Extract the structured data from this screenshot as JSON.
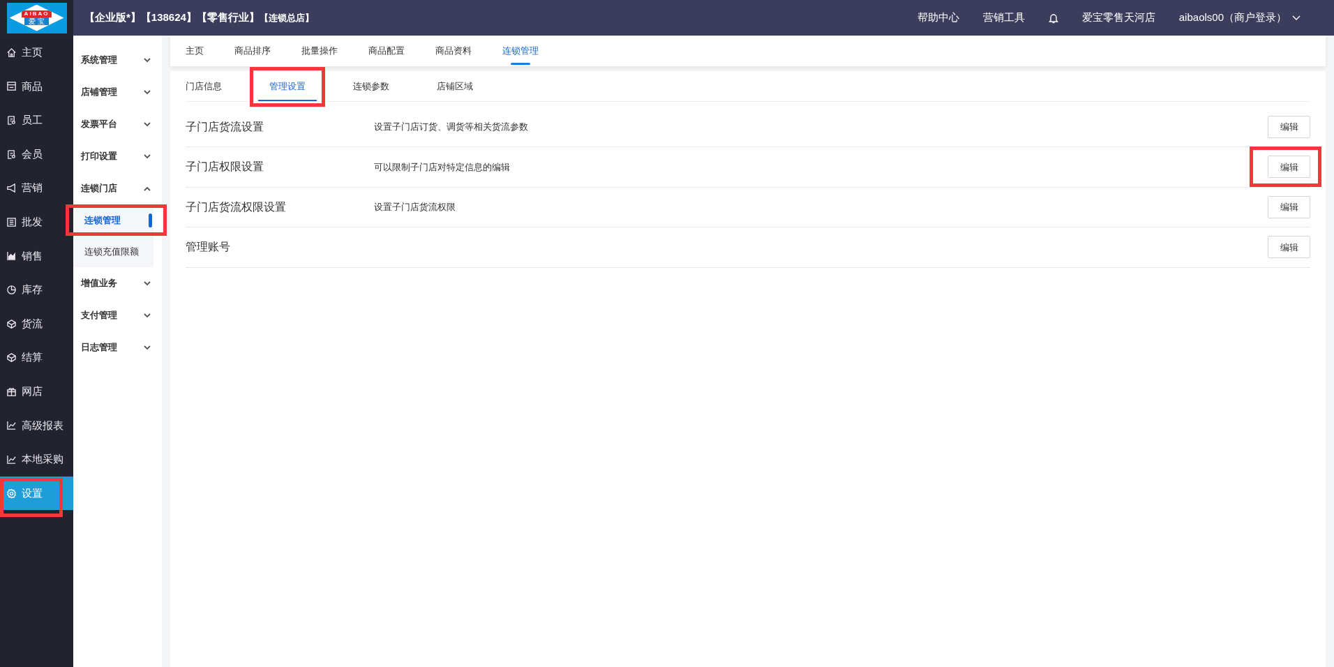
{
  "logo": {
    "brand": "AIBAO",
    "subtitle": "爱 宝"
  },
  "header": {
    "tags": [
      {
        "text": "【企业版*】",
        "small": false
      },
      {
        "text": "【138624】",
        "small": false
      },
      {
        "text": "【零售行业】",
        "small": false
      },
      {
        "text": "【连锁总店】",
        "small": true
      }
    ],
    "links": [
      "帮助中心",
      "营销工具"
    ],
    "store": "爱宝零售天河店",
    "user": "aibaols00（商户登录）"
  },
  "main_nav": [
    {
      "label": "主页",
      "selected": false,
      "highlighted": false
    },
    {
      "label": "商品",
      "selected": false,
      "highlighted": false
    },
    {
      "label": "员工",
      "selected": false,
      "highlighted": false
    },
    {
      "label": "会员",
      "selected": false,
      "highlighted": false
    },
    {
      "label": "营销",
      "selected": false,
      "highlighted": false
    },
    {
      "label": "批发",
      "selected": false,
      "highlighted": false
    },
    {
      "label": "销售",
      "selected": false,
      "highlighted": false
    },
    {
      "label": "库存",
      "selected": false,
      "highlighted": false
    },
    {
      "label": "货流",
      "selected": false,
      "highlighted": false
    },
    {
      "label": "结算",
      "selected": false,
      "highlighted": false
    },
    {
      "label": "网店",
      "selected": false,
      "highlighted": false
    },
    {
      "label": "高级报表",
      "selected": false,
      "highlighted": false
    },
    {
      "label": "本地采购",
      "selected": false,
      "highlighted": false
    },
    {
      "label": "设置",
      "selected": true,
      "highlighted": true
    }
  ],
  "sub_nav": [
    {
      "label": "系统管理",
      "expanded": false
    },
    {
      "label": "店铺管理",
      "expanded": false
    },
    {
      "label": "发票平台",
      "expanded": false
    },
    {
      "label": "打印设置",
      "expanded": false
    },
    {
      "label": "连锁门店",
      "expanded": true,
      "children": [
        {
          "label": "连锁管理",
          "selected": true,
          "highlighted": true
        },
        {
          "label": "连锁充值限额",
          "selected": false,
          "highlighted": false
        }
      ]
    },
    {
      "label": "增值业务",
      "expanded": false
    },
    {
      "label": "支付管理",
      "expanded": false
    },
    {
      "label": "日志管理",
      "expanded": false
    }
  ],
  "top_tabs": [
    {
      "label": "主页",
      "selected": false
    },
    {
      "label": "商品排序",
      "selected": false
    },
    {
      "label": "批量操作",
      "selected": false
    },
    {
      "label": "商品配置",
      "selected": false
    },
    {
      "label": "商品资料",
      "selected": false
    },
    {
      "label": "连锁管理",
      "selected": true
    }
  ],
  "sub_tabs": [
    {
      "label": "门店信息",
      "selected": false,
      "highlighted": false
    },
    {
      "label": "管理设置",
      "selected": true,
      "highlighted": true
    },
    {
      "label": "连锁参数",
      "selected": false,
      "highlighted": false
    },
    {
      "label": "店铺区域",
      "selected": false,
      "highlighted": false
    }
  ],
  "settings": [
    {
      "title": "子门店货流设置",
      "description": "设置子门店订货、调货等相关货流参数",
      "button": "编辑",
      "highlighted": false
    },
    {
      "title": "子门店权限设置",
      "description": "可以限制子门店对特定信息的编辑",
      "button": "编辑",
      "highlighted": true
    },
    {
      "title": "子门店货流权限设置",
      "description": "设置子门店货流权限",
      "button": "编辑",
      "highlighted": false
    },
    {
      "title": "管理账号",
      "button": "编辑",
      "highlighted": false
    }
  ]
}
